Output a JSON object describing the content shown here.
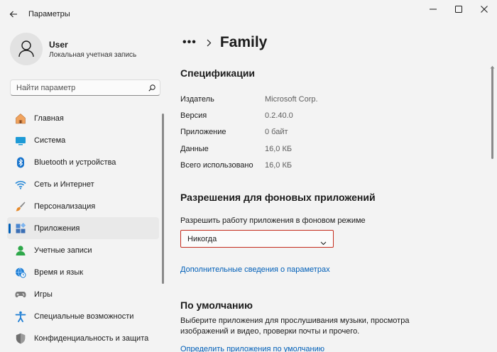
{
  "window": {
    "title": "Параметры"
  },
  "profile": {
    "name": "User",
    "account_type": "Локальная учетная запись"
  },
  "search": {
    "placeholder": "Найти параметр"
  },
  "sidebar": {
    "items": [
      {
        "label": "Главная",
        "icon": "home-icon",
        "active": false
      },
      {
        "label": "Система",
        "icon": "system-icon",
        "active": false
      },
      {
        "label": "Bluetooth и устройства",
        "icon": "bluetooth-icon",
        "active": false
      },
      {
        "label": "Сеть и Интернет",
        "icon": "wifi-icon",
        "active": false
      },
      {
        "label": "Персонализация",
        "icon": "brush-icon",
        "active": false
      },
      {
        "label": "Приложения",
        "icon": "apps-icon",
        "active": true
      },
      {
        "label": "Учетные записи",
        "icon": "account-icon",
        "active": false
      },
      {
        "label": "Время и язык",
        "icon": "globe-clock-icon",
        "active": false
      },
      {
        "label": "Игры",
        "icon": "gamepad-icon",
        "active": false
      },
      {
        "label": "Специальные возможности",
        "icon": "accessibility-icon",
        "active": false
      },
      {
        "label": "Конфиденциальность и защита",
        "icon": "shield-icon",
        "active": false
      }
    ]
  },
  "breadcrumb": {
    "ellipsis": "•••",
    "current": "Family"
  },
  "specs": {
    "title": "Спецификации",
    "rows": [
      {
        "label": "Издатель",
        "value": "Microsoft Corp."
      },
      {
        "label": "Версия",
        "value": "0.2.40.0"
      },
      {
        "label": "Приложение",
        "value": "0 байт"
      },
      {
        "label": "Данные",
        "value": "16,0 КБ"
      },
      {
        "label": "Всего использовано",
        "value": "16,0 КБ"
      }
    ]
  },
  "background": {
    "title": "Разрешения для фоновых приложений",
    "label": "Разрешить работу приложения в фоновом режиме",
    "selected": "Никогда",
    "more_link": "Дополнительные сведения о параметрах"
  },
  "defaults": {
    "title": "По умолчанию",
    "description": "Выберите приложения для прослушивания музыки, просмотра изображений и видео, проверки почты и прочего.",
    "link": "Определить приложения по умолчанию"
  },
  "colors": {
    "accent": "#005fb8",
    "highlight_border": "#c42b1c",
    "background": "#f3f3f3"
  }
}
